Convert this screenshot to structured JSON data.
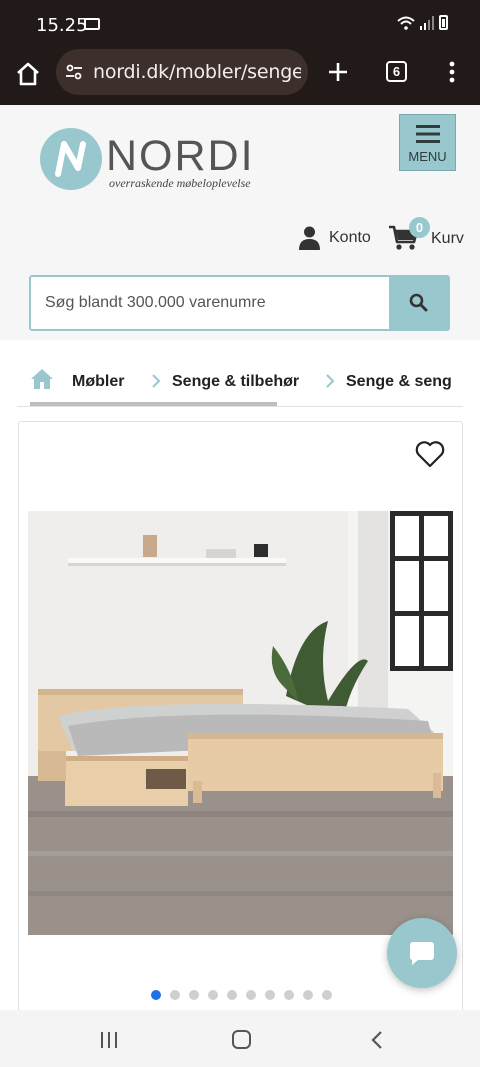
{
  "status_bar": {
    "time": "15.25"
  },
  "browser": {
    "url": "nordi.dk/mobler/senge-",
    "tab_count": "6"
  },
  "header": {
    "logo_text": "NORDI",
    "logo_tagline": "overraskende møbeloplevelse",
    "menu_label": "MENU",
    "account_label": "Konto",
    "cart_label": "Kurv",
    "cart_count": "0",
    "search_placeholder": "Søg blandt 300.000 varenumre"
  },
  "breadcrumb": {
    "items": [
      "Møbler",
      "Senge & tilbehør",
      "Senge & seng"
    ]
  },
  "product": {
    "image_count": 10,
    "active_image": 1
  },
  "colors": {
    "accent": "#98c8cd",
    "dark_bar": "#211a18",
    "active_dot": "#1a73e8"
  },
  "icons": [
    "home-icon",
    "tune-icon",
    "plus-icon",
    "tabs-icon",
    "kebab-icon",
    "hamburger-icon",
    "user-icon",
    "cart-icon",
    "search-icon",
    "chevron-right-icon",
    "heart-icon",
    "chat-icon"
  ]
}
